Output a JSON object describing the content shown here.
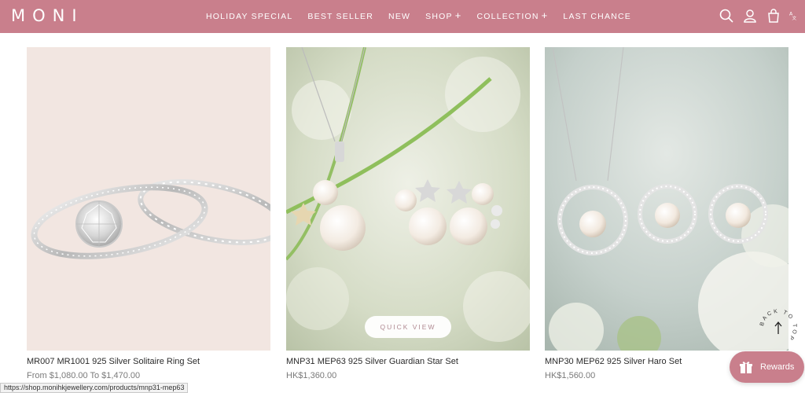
{
  "header": {
    "logo": "MONI",
    "nav": [
      {
        "label": "HOLIDAY SPECIAL",
        "has_plus": false
      },
      {
        "label": "BEST SELLER",
        "has_plus": false
      },
      {
        "label": "NEW",
        "has_plus": false
      },
      {
        "label": "SHOP",
        "has_plus": true
      },
      {
        "label": "COLLECTION",
        "has_plus": true
      },
      {
        "label": "LAST CHANCE",
        "has_plus": false
      }
    ],
    "icons": [
      "search-icon",
      "account-icon",
      "cart-icon",
      "language-icon"
    ],
    "background": "#c97f8c"
  },
  "products": [
    {
      "name": "MR007 MR1001 925 Silver Solitaire Ring Set",
      "price": "From $1,080.00 To $1,470.00"
    },
    {
      "name": "MNP31 MEP63 925 Silver Guardian Star Set",
      "price": "HK$1,360.00",
      "quick_view": "QUICK VIEW"
    },
    {
      "name": "MNP30 MEP62 925 Silver Haro Set",
      "price": "HK$1,560.00"
    }
  ],
  "back_to_top": "BACK TO TOP",
  "rewards": {
    "label": "Rewards"
  },
  "status_url": "https://shop.monihkjewellery.com/products/mnp31-mep63"
}
